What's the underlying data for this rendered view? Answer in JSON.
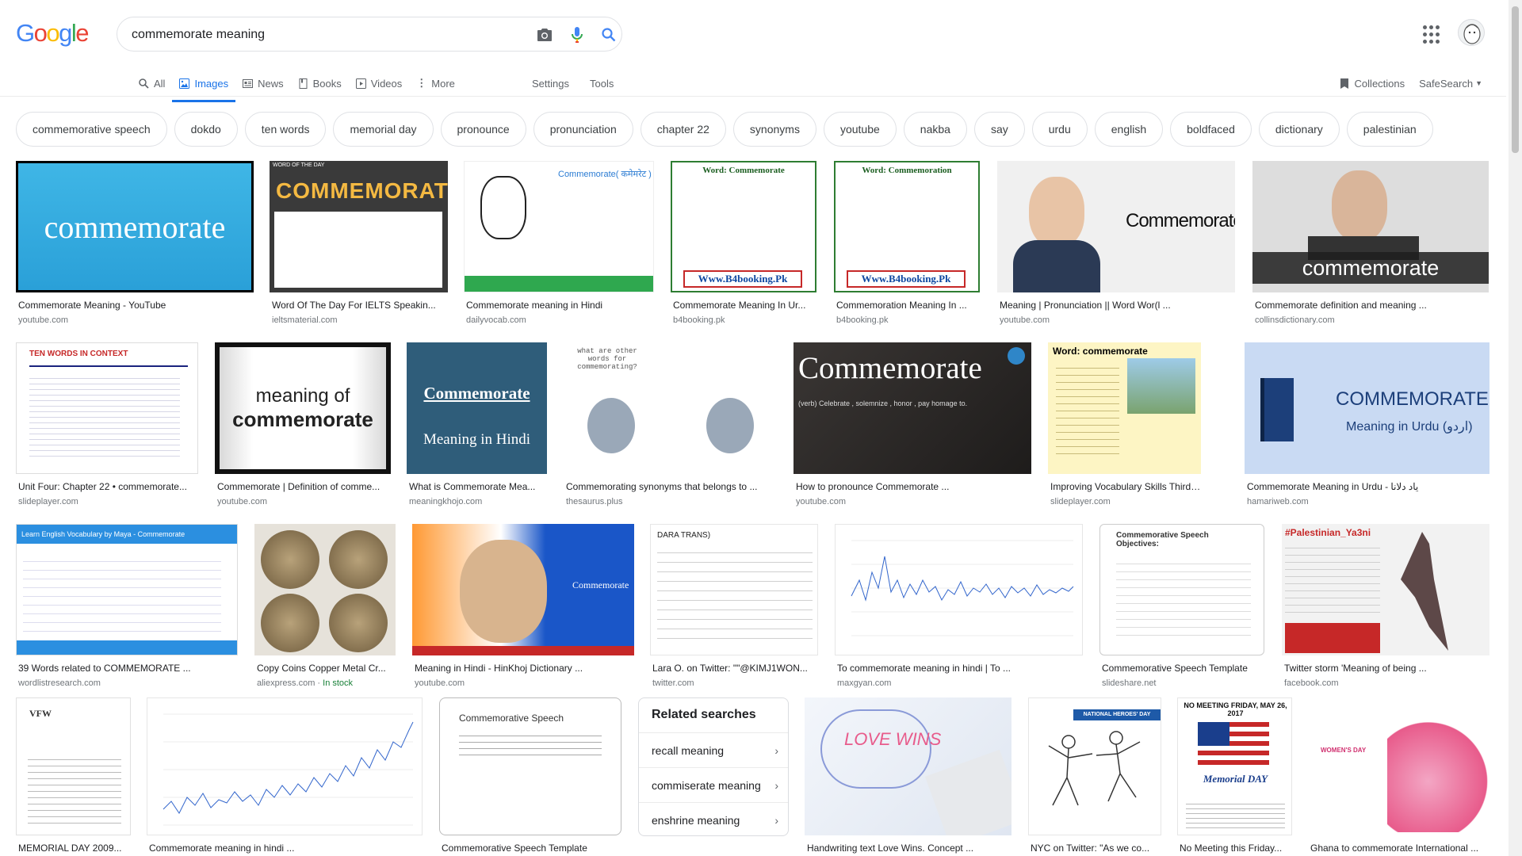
{
  "logo": {
    "letters": [
      {
        "ch": "G",
        "color": "#4285F4"
      },
      {
        "ch": "o",
        "color": "#EA4335"
      },
      {
        "ch": "o",
        "color": "#FBBC05"
      },
      {
        "ch": "g",
        "color": "#4285F4"
      },
      {
        "ch": "l",
        "color": "#34A853"
      },
      {
        "ch": "e",
        "color": "#EA4335"
      }
    ]
  },
  "search": {
    "query": "commemorate meaning"
  },
  "tabs": [
    {
      "label": "All",
      "active": false
    },
    {
      "label": "Images",
      "active": true
    },
    {
      "label": "News",
      "active": false
    },
    {
      "label": "Books",
      "active": false
    },
    {
      "label": "Videos",
      "active": false
    },
    {
      "label": "More",
      "active": false
    }
  ],
  "tools": {
    "settings": "Settings",
    "tools": "Tools",
    "collections": "Collections",
    "safesearch": "SafeSearch"
  },
  "chips": [
    "commemorative speech",
    "dokdo",
    "ten words",
    "memorial day",
    "pronounce",
    "pronunciation",
    "chapter 22",
    "synonyms",
    "youtube",
    "nakba",
    "say",
    "urdu",
    "english",
    "boldfaced",
    "dictionary",
    "palestinian"
  ],
  "results": {
    "r1": [
      {
        "caption": "Commemorate Meaning - YouTube",
        "source": "youtube.com",
        "text": "commemorate"
      },
      {
        "caption": "Word Of The Day For IELTS Speakin...",
        "source": "ieltsmaterial.com",
        "text": "COMMEMORATE",
        "text2": "WORD OF THE DAY"
      },
      {
        "caption": "Commemorate meaning in Hindi",
        "source": "dailyvocab.com",
        "text": "Commemorate( कमेमरेट )"
      },
      {
        "caption": "Commemorate Meaning In Ur...",
        "source": "b4booking.pk",
        "text": "Word: Commemorate",
        "text2": "Www.B4booking.Pk"
      },
      {
        "caption": "Commemoration Meaning In ...",
        "source": "b4booking.pk",
        "text": "Word: Commemoration",
        "text2": "Www.B4booking.Pk"
      },
      {
        "caption": "Meaning | Pronunciation || Word Wor(l ...",
        "source": "youtube.com",
        "text": "Commemorate"
      },
      {
        "caption": "Commemorate definition and meaning ...",
        "source": "collinsdictionary.com",
        "text": "commemorate"
      }
    ],
    "r2": [
      {
        "caption": "Unit Four: Chapter 22 • commemorate...",
        "source": "slideplayer.com",
        "text": "TEN WORDS IN CONTEXT"
      },
      {
        "caption": "Commemorate | Definition of comme...",
        "source": "youtube.com",
        "text": "meaning of",
        "text2": "commemorate"
      },
      {
        "caption": "What is Commemorate Mea...",
        "source": "meaningkhojo.com",
        "text": "Commemorate",
        "text2": "Meaning in Hindi"
      },
      {
        "caption": "Commemorating synonyms that belongs to ...",
        "source": "thesaurus.plus",
        "text": "what are other words for commemorating?"
      },
      {
        "caption": "How to pronounce Commemorate ...",
        "source": "youtube.com",
        "text": "Commemorate",
        "text2": "(verb) Celebrate , solemnize , honor , pay homage to."
      },
      {
        "caption": "Improving Vocabulary Skills Third ...",
        "source": "slideplayer.com",
        "text": "Word: commemorate"
      },
      {
        "caption": "Commemorate Meaning in Urdu - یاد دلانا",
        "source": "hamariweb.com",
        "text": "COMMEMORATE",
        "text2": "Meaning in Urdu (اردو)"
      }
    ],
    "r3": [
      {
        "caption": "39 Words related to COMMEMORATE ...",
        "source": "wordlistresearch.com",
        "text": "Learn English Vocabulary by Maya - Commemorate"
      },
      {
        "caption": "Copy Coins Copper Metal Cr...",
        "source": "aliexpress.com",
        "stock": "In stock"
      },
      {
        "caption": "Meaning in Hindi - HinKhoj Dictionary ...",
        "source": "youtube.com",
        "text": "Commemorate"
      },
      {
        "caption": "Lara O. on Twitter: \"\"@KIMJ1WON...",
        "source": "twitter.com",
        "text": "DARA TRANS)"
      },
      {
        "caption": "To commemorate meaning in hindi | To ...",
        "source": "maxgyan.com"
      },
      {
        "caption": "Commemorative Speech Template",
        "source": "slideshare.net",
        "text": "Commemorative Speech Objectives:"
      },
      {
        "caption": "Twitter storm 'Meaning of being ...",
        "source": "facebook.com",
        "text": "#Palestinian_Ya3ni"
      }
    ],
    "r4": [
      {
        "caption": "MEMORIAL DAY 2009...",
        "text": "VFW"
      },
      {
        "caption": "Commemorate meaning in hindi ..."
      },
      {
        "caption": "Commemorative Speech Template",
        "text": "Commemorative Speech"
      },
      {
        "caption": "Handwriting text Love Wins. Concept ...",
        "text": "LOVE WINS"
      },
      {
        "caption": "NYC on Twitter: \"As we co...",
        "text": "NATIONAL HEROES' DAY"
      },
      {
        "caption": "No Meeting this Friday...",
        "text": "NO MEETING FRIDAY, MAY 26, 2017",
        "text2": "Memorial DAY"
      },
      {
        "caption": "Ghana to commemorate International ...",
        "text": "WOMEN'S DAY"
      }
    ]
  },
  "related": {
    "title": "Related searches",
    "items": [
      "recall meaning",
      "commiserate meaning",
      "enshrine meaning"
    ]
  }
}
